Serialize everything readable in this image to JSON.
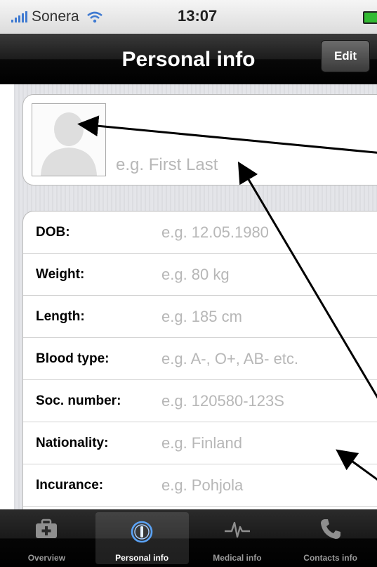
{
  "status_bar": {
    "carrier": "Sonera",
    "time": "13:07",
    "signal_icon": "signal-bars-icon",
    "wifi_icon": "wifi-icon",
    "battery_icon": "battery-charging-icon"
  },
  "nav": {
    "title": "Personal info",
    "edit_label": "Edit"
  },
  "profile": {
    "photo_icon": "person-silhouette-icon",
    "name_placeholder": "e.g. First Last"
  },
  "fields": [
    {
      "label": "DOB:",
      "placeholder": "e.g. 12.05.1980"
    },
    {
      "label": "Weight:",
      "placeholder": "e.g. 80 kg"
    },
    {
      "label": "Length:",
      "placeholder": "e.g. 185 cm"
    },
    {
      "label": "Blood type:",
      "placeholder": "e.g. A-, O+, AB- etc."
    },
    {
      "label": "Soc. number:",
      "placeholder": "e.g. 120580-123S"
    },
    {
      "label": "Nationality:",
      "placeholder": "e.g. Finland"
    },
    {
      "label": "Incurance:",
      "placeholder": "e.g. Pohjola"
    }
  ],
  "tabs": [
    {
      "label": "Overview",
      "icon": "first-aid-kit-icon",
      "selected": false
    },
    {
      "label": "Personal info",
      "icon": "info-icon",
      "selected": true
    },
    {
      "label": "Medical info",
      "icon": "heartbeat-icon",
      "selected": false
    },
    {
      "label": "Contacts info",
      "icon": "phone-icon",
      "selected": false
    }
  ],
  "colors": {
    "accent": "#3f7ad1",
    "placeholder_text": "#b7b7b7",
    "background_stripes": "#e4e5e9",
    "annotation_arrow": "#000000"
  }
}
